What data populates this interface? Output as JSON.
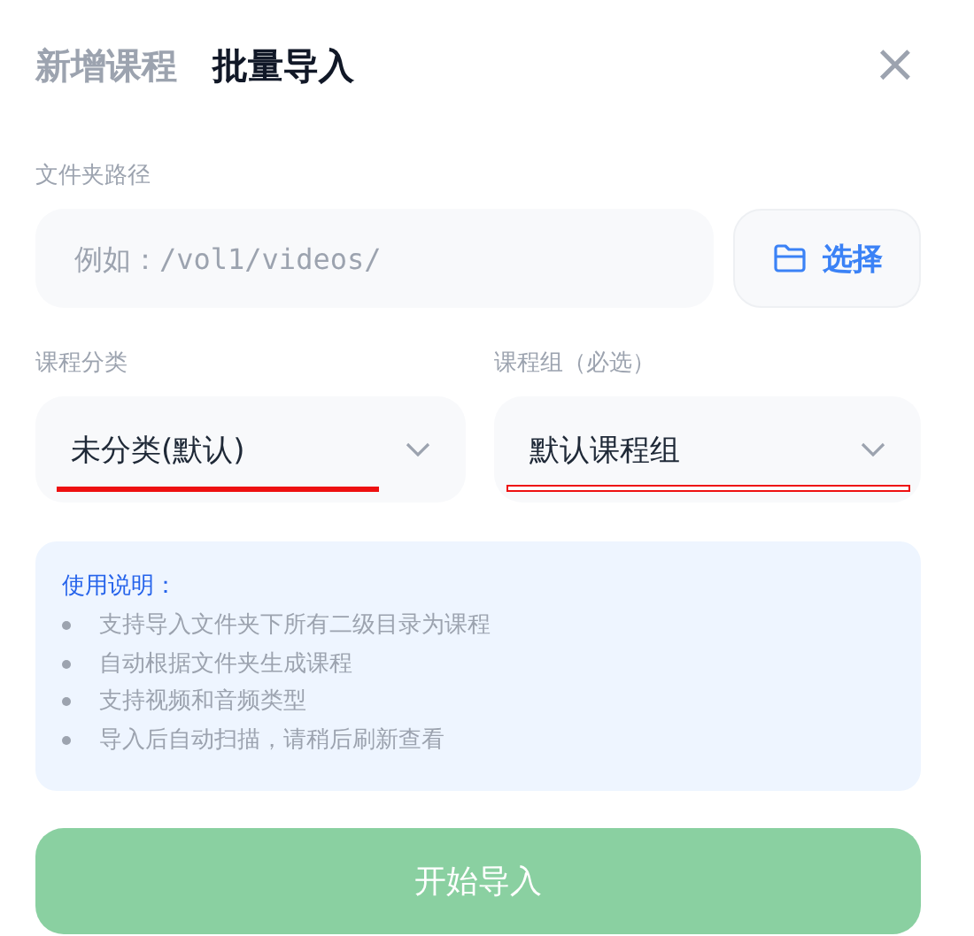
{
  "tabs": [
    {
      "label": "新增课程",
      "selected": false
    },
    {
      "label": "批量导入",
      "selected": true
    }
  ],
  "close": "×",
  "folder": {
    "label": "文件夹路径",
    "placeholder": "例如：/vol1/videos/",
    "button": "选择"
  },
  "selects": [
    {
      "label": "课程分类",
      "value": "未分类(默认)",
      "marked": true
    },
    {
      "label": "课程组（必选）",
      "value": "默认课程组",
      "marked": true
    }
  ],
  "notes": {
    "title": "使用说明：",
    "items": [
      "支持导入文件夹下所有二级目录为课程",
      "自动根据文件夹生成课程",
      "支持视频和音频类型",
      "导入后自动扫描，请稍后刷新查看"
    ]
  },
  "submit": {
    "label": "开始导入",
    "disabled": true
  }
}
